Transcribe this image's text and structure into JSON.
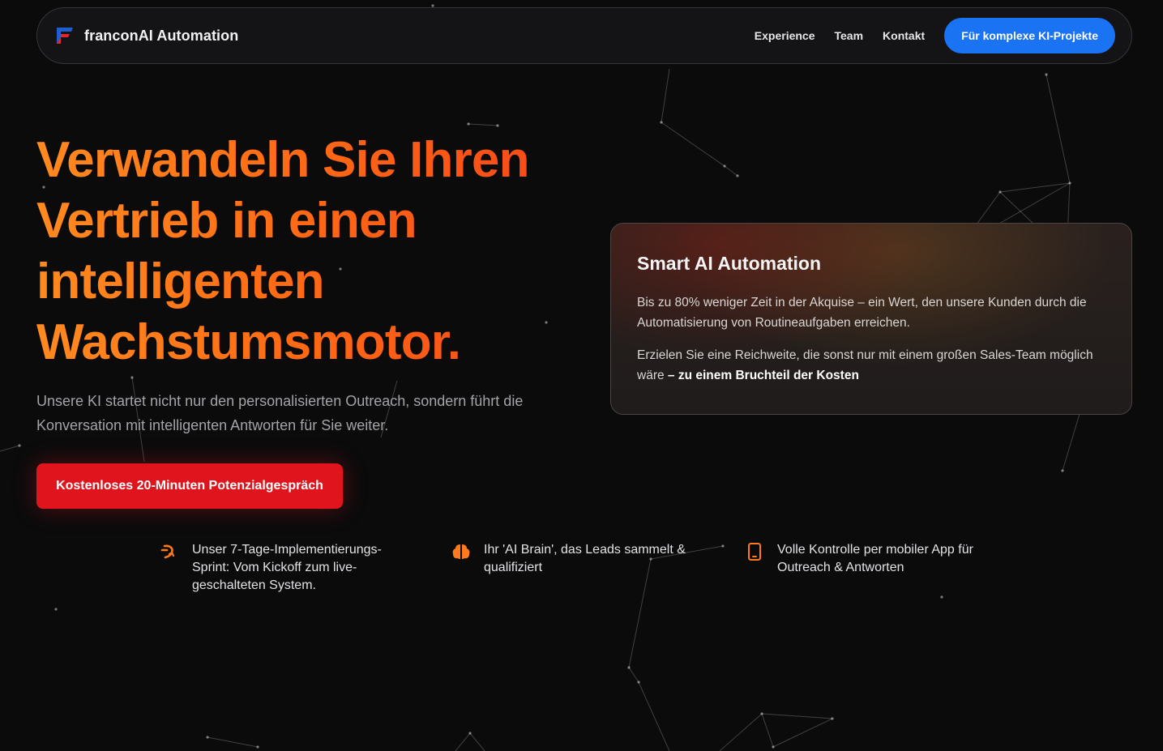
{
  "nav": {
    "brand": "franconAI Automation",
    "links": [
      "Experience",
      "Team",
      "Kontakt"
    ],
    "cta": "Für komplexe KI-Projekte"
  },
  "hero": {
    "title": "Verwandeln Sie Ihren Vertrieb in einen intelligenten Wachstumsmotor.",
    "subtitle": "Unsere KI startet nicht nur den personalisierten Outreach, sondern führt die Konversation mit intelligenten Antworten für Sie weiter.",
    "cta": "Kostenloses 20-Minuten Potenzialgespräch"
  },
  "card": {
    "title": "Smart AI Automation",
    "p1": "Bis zu 80% weniger Zeit in der Akquise – ein Wert, den unsere Kunden durch die Automatisierung von Routineaufgaben erreichen.",
    "p2_lead": "Erzielen Sie eine Reichweite, die sonst nur mit einem großen Sales-Team möglich wäre",
    "p2_strong": "– zu einem Bruchteil der Kosten"
  },
  "features": [
    {
      "icon": "arrow-sprint-icon",
      "text": "Unser 7-Tage-Implementierungs-Sprint: Vom Kickoff zum live-geschalteten System."
    },
    {
      "icon": "brain-icon",
      "text": "Ihr 'AI Brain', das Leads sammelt & qualifiziert"
    },
    {
      "icon": "mobile-icon",
      "text": "Volle Kontrolle per mobiler App für Outreach & Antworten"
    }
  ],
  "colors": {
    "accent_orange": "#ff6a14",
    "cta_red": "#e0141c",
    "nav_blue": "#1a73f2",
    "background": "#0b0b0c"
  }
}
